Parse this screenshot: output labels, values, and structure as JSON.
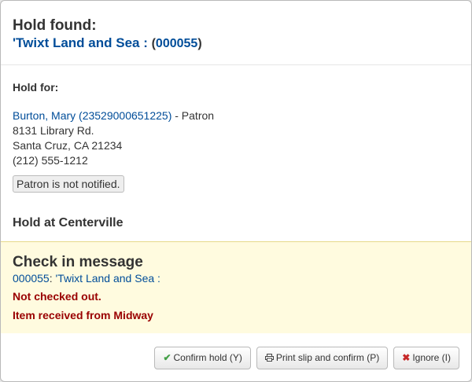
{
  "header": {
    "title": "Hold found:",
    "item_title": "'Twixt Land and Sea :",
    "open_paren": "(",
    "barcode": "000055",
    "close_paren": ")"
  },
  "hold_for": {
    "label": "Hold for:",
    "patron_link": "Burton, Mary (23529000651225)",
    "patron_suffix": "- Patron",
    "address_line1": "8131 Library Rd.",
    "address_line2": "Santa Cruz, CA 21234",
    "phone": "(212) 555-1212",
    "notify_status": "Patron is not notified."
  },
  "hold_at": "Hold at Centerville",
  "checkin": {
    "title": "Check in message",
    "barcode_link": "000055",
    "separator": ":",
    "title_link": "'Twixt Land and Sea :",
    "message1": "Not checked out.",
    "message2": "Item received from Midway"
  },
  "buttons": {
    "confirm": "Confirm hold (Y)",
    "print": "Print slip and confirm (P)",
    "ignore": "Ignore (I)"
  },
  "icons": {
    "confirm": "check-icon",
    "print": "printer-icon",
    "ignore": "close-icon"
  },
  "colors": {
    "link": "#004d99",
    "warning": "#990000",
    "panel": "#fffbdf"
  }
}
